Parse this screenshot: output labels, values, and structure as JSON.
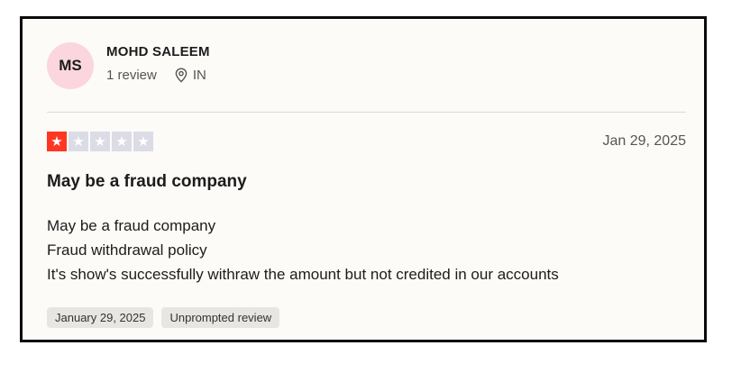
{
  "review": {
    "author": {
      "initials": "MS",
      "name": "MOHD SALEEM",
      "review_count": "1 review",
      "country": "IN"
    },
    "rating": 1,
    "rating_max": 5,
    "date": "Jan 29, 2025",
    "title": "May be a fraud company",
    "body_lines": [
      "May be a fraud company",
      "Fraud withdrawal policy",
      "It's show's successfully withraw the amount but not credited in our accounts"
    ],
    "tags": [
      "January 29, 2025",
      "Unprompted review"
    ],
    "colors": {
      "star_filled": "#ff3722",
      "star_empty": "#dcdce6",
      "avatar_bg": "#fbd6de"
    }
  }
}
